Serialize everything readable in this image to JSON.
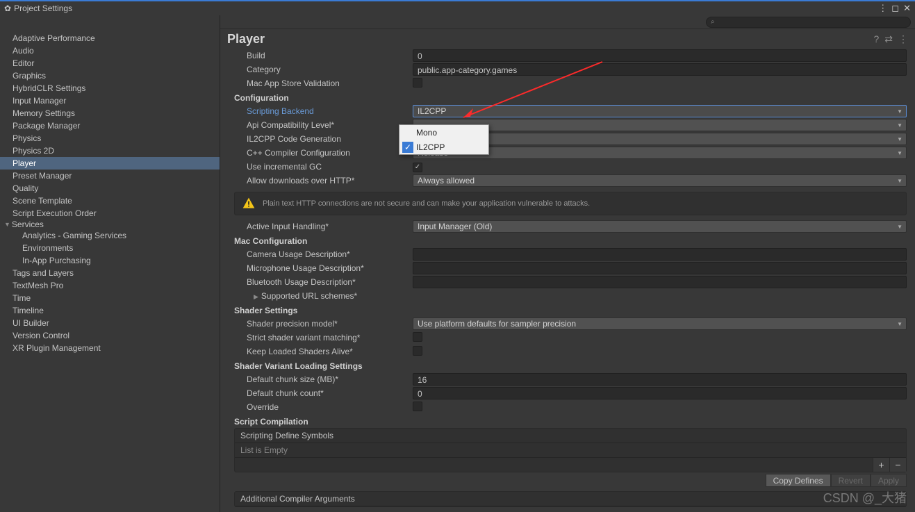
{
  "window": {
    "title": "Project Settings"
  },
  "sidebar": {
    "items": [
      "Adaptive Performance",
      "Audio",
      "Editor",
      "Graphics",
      "HybridCLR Settings",
      "Input Manager",
      "Memory Settings",
      "Package Manager",
      "Physics",
      "Physics 2D",
      "Player",
      "Preset Manager",
      "Quality",
      "Scene Template",
      "Script Execution Order"
    ],
    "services_label": "Services",
    "services": [
      "Analytics - Gaming Services",
      "Environments",
      "In-App Purchasing"
    ],
    "items2": [
      "Tags and Layers",
      "TextMesh Pro",
      "Time",
      "Timeline",
      "UI Builder",
      "Version Control",
      "XR Plugin Management"
    ],
    "selected": "Player"
  },
  "page": {
    "title": "Player"
  },
  "fields": {
    "build_label": "Build",
    "build_value": "0",
    "category_label": "Category",
    "category_value": "public.app-category.games",
    "macstore_label": "Mac App Store Validation",
    "config_head": "Configuration",
    "scripting_backend_label": "Scripting Backend",
    "scripting_backend_value": "IL2CPP",
    "api_compat_label": "Api Compatibility Level*",
    "il2cpp_gen_label": "IL2CPP Code Generation",
    "cpp_compiler_label": "C++ Compiler Configuration",
    "cpp_compiler_value": "Release",
    "incr_gc_label": "Use incremental GC",
    "allow_http_label": "Allow downloads over HTTP*",
    "allow_http_value": "Always allowed",
    "http_warning": "Plain text HTTP connections are not secure and can make your application vulnerable to attacks.",
    "active_input_label": "Active Input Handling*",
    "active_input_value": "Input Manager (Old)",
    "mac_head": "Mac Configuration",
    "cam_label": "Camera Usage Description*",
    "mic_label": "Microphone Usage Description*",
    "bt_label": "Bluetooth Usage Description*",
    "url_schemes_label": "Supported URL schemes*",
    "shader_head": "Shader Settings",
    "shader_prec_label": "Shader precision model*",
    "shader_prec_value": "Use platform defaults for sampler precision",
    "strict_variant_label": "Strict shader variant matching*",
    "keep_loaded_label": "Keep Loaded Shaders Alive*",
    "variant_head": "Shader Variant Loading Settings",
    "chunk_size_label": "Default chunk size (MB)*",
    "chunk_size_value": "16",
    "chunk_count_label": "Default chunk count*",
    "chunk_count_value": "0",
    "override_label": "Override",
    "compile_head": "Script Compilation",
    "define_symbols_label": "Scripting Define Symbols",
    "list_empty": "List is Empty",
    "copy_defines": "Copy Defines",
    "revert": "Revert",
    "apply": "Apply",
    "add_args_label": "Additional Compiler Arguments"
  },
  "popup": {
    "options": [
      "Mono",
      "IL2CPP"
    ],
    "selected": "IL2CPP"
  },
  "watermark": "CSDN @_大猪"
}
